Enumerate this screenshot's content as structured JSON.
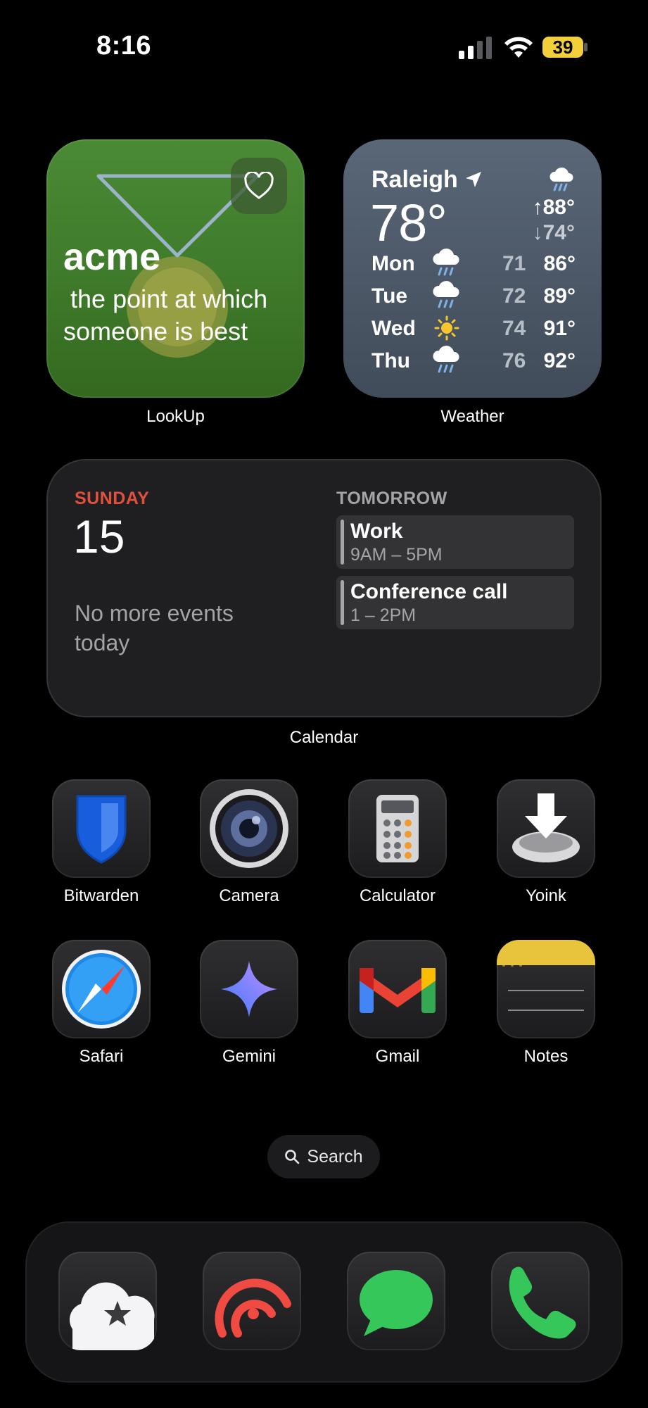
{
  "status": {
    "time": "8:16",
    "battery": "39"
  },
  "widgets": {
    "lookup": {
      "word": "acme",
      "definition": " the point at which someone is best",
      "label": "LookUp"
    },
    "weather": {
      "city": "Raleigh",
      "temp": "78°",
      "high": "↑88°",
      "low": "↓74°",
      "label": "Weather",
      "forecast": [
        {
          "day": "Mon",
          "icon": "cloud-rain-icon",
          "low": "71",
          "high": "86°"
        },
        {
          "day": "Tue",
          "icon": "cloud-rain-icon",
          "low": "72",
          "high": "89°"
        },
        {
          "day": "Wed",
          "icon": "sun-icon",
          "low": "74",
          "high": "91°"
        },
        {
          "day": "Thu",
          "icon": "cloud-rain-icon",
          "low": "76",
          "high": "92°"
        }
      ]
    },
    "calendar": {
      "weekday": "SUNDAY",
      "date": "15",
      "no_events": "No more events today",
      "tomorrow": "TOMORROW",
      "events": [
        {
          "title": "Work",
          "time": "9AM – 5PM"
        },
        {
          "title": "Conference call",
          "time": "1 – 2PM"
        }
      ],
      "label": "Calendar"
    }
  },
  "apps": [
    {
      "name": "Bitwarden",
      "icon": "shield-icon"
    },
    {
      "name": "Camera",
      "icon": "camera-icon"
    },
    {
      "name": "Calculator",
      "icon": "calculator-icon"
    },
    {
      "name": "Yoink",
      "icon": "download-tray-icon"
    },
    {
      "name": "Safari",
      "icon": "compass-icon"
    },
    {
      "name": "Gemini",
      "icon": "sparkle-icon"
    },
    {
      "name": "Gmail",
      "icon": "gmail-icon"
    },
    {
      "name": "Notes",
      "icon": "notes-icon"
    }
  ],
  "search": {
    "label": "Search"
  },
  "dock": [
    {
      "icon": "cloud-star-icon"
    },
    {
      "icon": "podcast-icon"
    },
    {
      "icon": "message-bubble-icon"
    },
    {
      "icon": "phone-icon"
    }
  ]
}
